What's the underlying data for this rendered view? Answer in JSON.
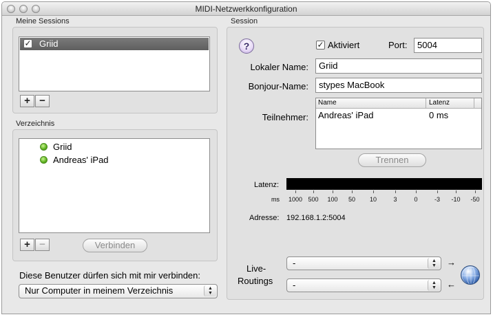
{
  "window": {
    "title": "MIDI-Netzwerkkonfiguration"
  },
  "sessions": {
    "heading": "Meine Sessions",
    "items": [
      {
        "name": "Griid",
        "checked": true
      }
    ],
    "add_label": "+",
    "remove_label": "−"
  },
  "directory": {
    "heading": "Verzeichnis",
    "items": [
      {
        "name": "Griid"
      },
      {
        "name": "Andreas' iPad"
      }
    ],
    "add_label": "+",
    "remove_label": "−",
    "connect_label": "Verbinden"
  },
  "permission": {
    "label": "Diese Benutzer dürfen sich mit mir verbinden:",
    "selected": "Nur Computer in meinem Verzeichnis"
  },
  "session": {
    "heading": "Session",
    "help_label": "?",
    "enabled_label": "Aktiviert",
    "enabled_checked": true,
    "port_label": "Port:",
    "port_value": "5004",
    "local_name_label": "Lokaler Name:",
    "local_name_value": "Griid",
    "bonjour_name_label": "Bonjour-Name:",
    "bonjour_name_value": "stypes MacBook",
    "participants_label": "Teilnehmer:",
    "participants_columns": [
      "Name",
      "Latenz"
    ],
    "participants_rows": [
      {
        "name": "Andreas' iPad",
        "latency": "0 ms"
      }
    ],
    "disconnect_label": "Trennen",
    "latency_label": "Latenz:",
    "latency_unit": "ms",
    "latency_ticks": [
      "1000",
      "500",
      "100",
      "50",
      "10",
      "3",
      "0",
      "-3",
      "-10",
      "-50"
    ],
    "address_label": "Adresse:",
    "address_value": "192.168.1.2:5004",
    "live_routings_label_1": "Live-",
    "live_routings_label_2": "Routings",
    "routing_in_value": "-",
    "routing_out_value": "-",
    "arrow_in": "→",
    "arrow_out": "←"
  },
  "icons": {
    "check": "✓",
    "popup_arrows_up": "▲",
    "popup_arrows_down": "▼"
  }
}
